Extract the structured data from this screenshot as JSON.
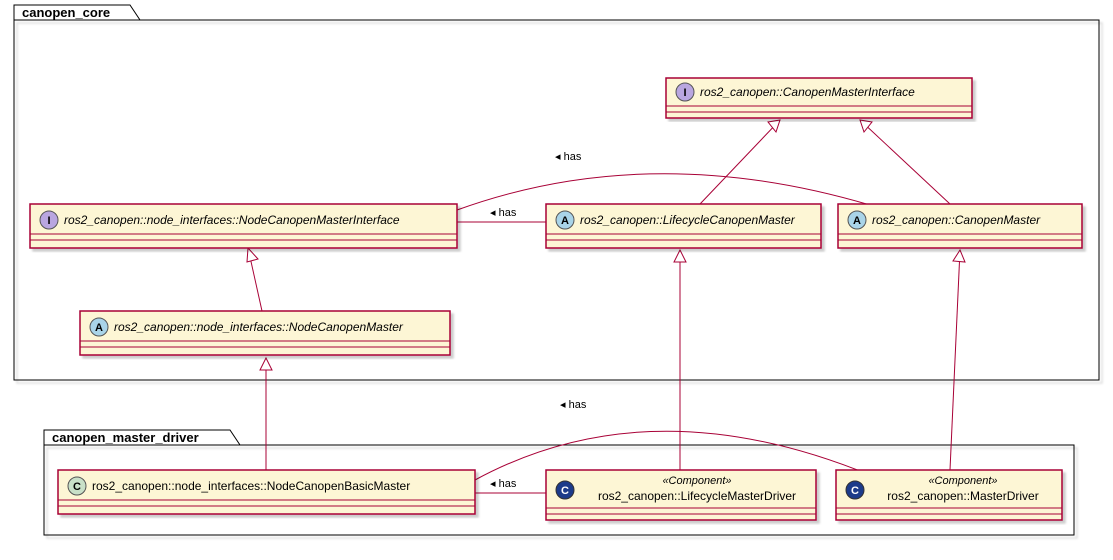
{
  "packages": {
    "core": {
      "label": "canopen_core"
    },
    "driver": {
      "label": "canopen_master_driver"
    }
  },
  "classes": {
    "cmi": {
      "name": "ros2_canopen::CanopenMasterInterface",
      "stereo": "I"
    },
    "ncmi": {
      "name": "ros2_canopen::node_interfaces::NodeCanopenMasterInterface",
      "stereo": "I"
    },
    "lcm": {
      "name": "ros2_canopen::LifecycleCanopenMaster",
      "stereo": "A"
    },
    "cm": {
      "name": "ros2_canopen::CanopenMaster",
      "stereo": "A"
    },
    "ncm": {
      "name": "ros2_canopen::node_interfaces::NodeCanopenMaster",
      "stereo": "A"
    },
    "ncbm": {
      "name": "ros2_canopen::node_interfaces::NodeCanopenBasicMaster",
      "stereo": "C"
    },
    "lmd": {
      "name": "ros2_canopen::LifecycleMasterDriver",
      "stereo": "C",
      "stereotype": "«Component»"
    },
    "md": {
      "name": "ros2_canopen::MasterDriver",
      "stereo": "C",
      "stereotype": "«Component»"
    }
  },
  "labels": {
    "has": "has"
  },
  "colors": {
    "I": "#b9a6e0",
    "A": "#a9d4e8",
    "C_light": "#c8e0c8",
    "C_dark": "#1e3a8a"
  }
}
